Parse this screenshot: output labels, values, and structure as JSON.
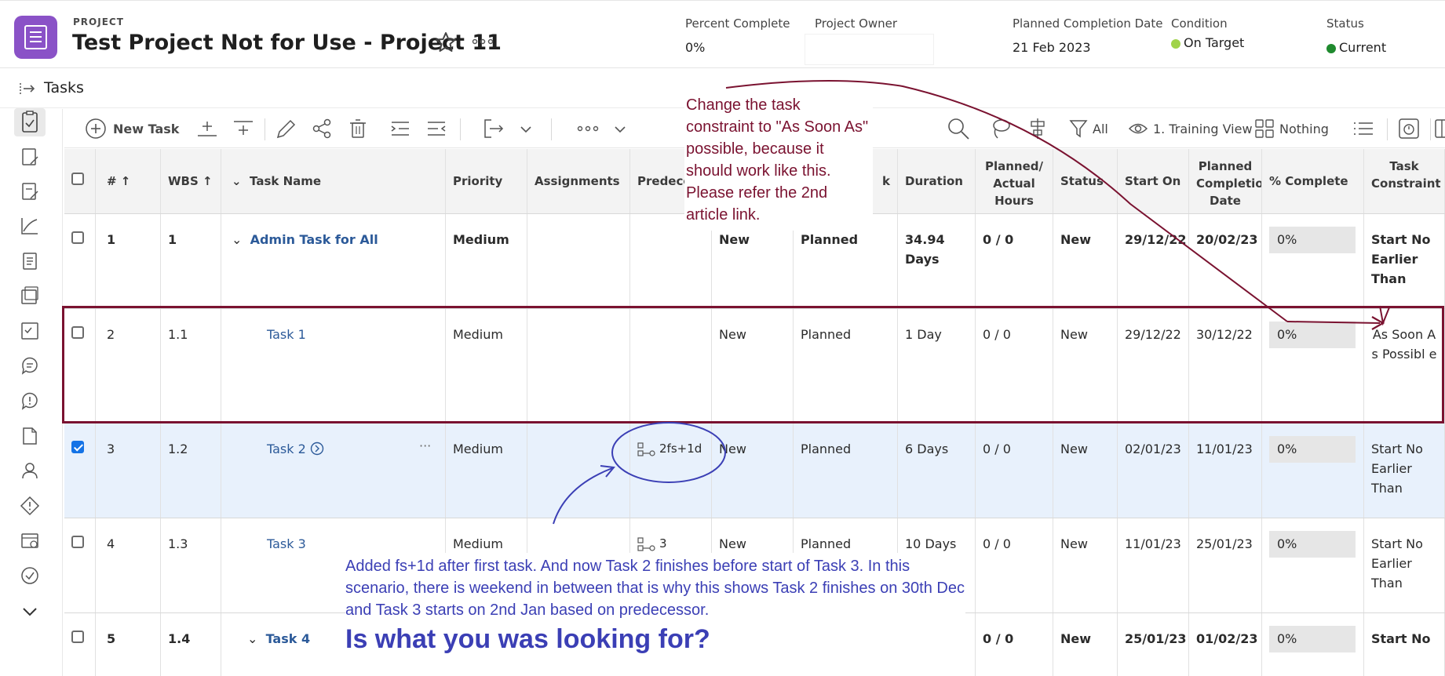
{
  "header": {
    "label": "PROJECT",
    "title": "Test Project Not for Use - Project 11",
    "percent_complete_label": "Percent Complete",
    "percent_complete_value": "0%",
    "owner_label": "Project Owner",
    "planned_completion_label": "Planned Completion Date",
    "planned_completion_value": "21 Feb 2023",
    "condition_label": "Condition",
    "condition_value": "On Target",
    "condition_color": "#a0d34a",
    "status_label": "Status",
    "status_value": "Current",
    "status_color": "#1f8a2e"
  },
  "tasks_bar": {
    "label": "Tasks"
  },
  "toolbar": {
    "new_task": "New Task",
    "filter_label": "All",
    "view_label": "1. Training View",
    "group_label": "Nothing"
  },
  "grid": {
    "columns": {
      "num": "#",
      "wbs": "WBS",
      "task_name": "Task Name",
      "priority": "Priority",
      "assignments": "Assignments",
      "predecessors": "Predeces",
      "col_status_hidden": "",
      "col_hidden_k": "k",
      "duration": "Duration",
      "hours": "Planned/ Actual Hours",
      "status": "Status",
      "start_on": "Start On",
      "planned_completion": "Planned Completion Date",
      "pct_complete": "% Complete",
      "constraint": "Task Constraint"
    },
    "rows": [
      {
        "num": "1",
        "wbs": "1",
        "name": "Admin Task for All",
        "priority": "Medium",
        "pred": "",
        "col7": "New",
        "col8": "Planned",
        "duration": "34.94 Days",
        "hours": "0 / 0",
        "status": "New",
        "start": "29/12/22",
        "end": "20/02/23",
        "pct": "0%",
        "constraint": "Start No Earlier Than"
      },
      {
        "num": "2",
        "wbs": "1.1",
        "name": "Task 1",
        "priority": "Medium",
        "pred": "",
        "col7": "New",
        "col8": "Planned",
        "duration": "1 Day",
        "hours": "0 / 0",
        "status": "New",
        "start": "29/12/22",
        "end": "30/12/22",
        "pct": "0%",
        "constraint": "As Soon As Possibl e"
      },
      {
        "num": "3",
        "wbs": "1.2",
        "name": "Task 2",
        "priority": "Medium",
        "pred": "2fs+1d",
        "col7": "New",
        "col8": "Planned",
        "duration": "6 Days",
        "hours": "0 / 0",
        "status": "New",
        "start": "02/01/23",
        "end": "11/01/23",
        "pct": "0%",
        "constraint": "Start No Earlier Than"
      },
      {
        "num": "4",
        "wbs": "1.3",
        "name": "Task 3",
        "priority": "Medium",
        "pred": "3",
        "col7": "New",
        "col8": "Planned",
        "duration": "10 Days",
        "hours": "0 / 0",
        "status": "New",
        "start": "11/01/23",
        "end": "25/01/23",
        "pct": "0%",
        "constraint": "Start No Earlier Than"
      },
      {
        "num": "5",
        "wbs": "1.4",
        "name": "Task 4",
        "priority": "",
        "pred": "",
        "col7": "",
        "col8": "",
        "duration": "",
        "hours": "0 / 0",
        "status": "New",
        "start": "25/01/23",
        "end": "01/02/23",
        "pct": "0%",
        "constraint": "Start No"
      }
    ]
  },
  "annotations": {
    "red_note": "Change the task constraint to \"As Soon As\" possible, because it should work like this. Please refer the 2nd article link.",
    "blue_note": "Added fs+1d after first task. And now Task 2 finishes before start of Task 3. In this scenario, there is weekend in between that is why this shows Task 2 finishes on 30th Dec and Task 3 starts on 2nd Jan based on predecessor.",
    "blue_question": "Is what you was looking for?"
  }
}
